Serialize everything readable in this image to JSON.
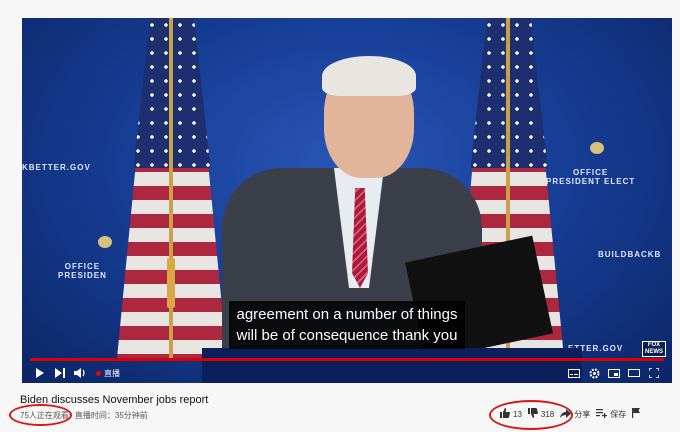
{
  "video": {
    "backdrop_text_left": "KBETTER.GOV",
    "backdrop_text_left_lower": "OFFICE\nPRESIDEN",
    "backdrop_text_right": "OFFICE\nPRESIDENT ELECT",
    "backdrop_text_right_lower": "BUILDBACKB",
    "backdrop_text_bottom_right": "ETTER.GOV",
    "captions": [
      "agreement on a number of things",
      "will be of consequence thank you"
    ],
    "network_logo": "FOX\nNEWS",
    "accent_color": "#dd0000"
  },
  "controls": {
    "play_icon": "play-icon",
    "next_icon": "next-icon",
    "volume_icon": "volume-icon",
    "live_label": "直播",
    "right_icons": [
      "subtitles-icon",
      "settings-icon",
      "miniplayer-icon",
      "theater-icon",
      "fullscreen-icon"
    ]
  },
  "info": {
    "title": "Biden discusses November jobs report",
    "viewers": "75人正在观看",
    "started": "直播时间：35分钟前"
  },
  "actions": {
    "likes": "13",
    "dislikes": "318",
    "share": "分享",
    "save": "保存",
    "annotation_color": "#d81818"
  }
}
